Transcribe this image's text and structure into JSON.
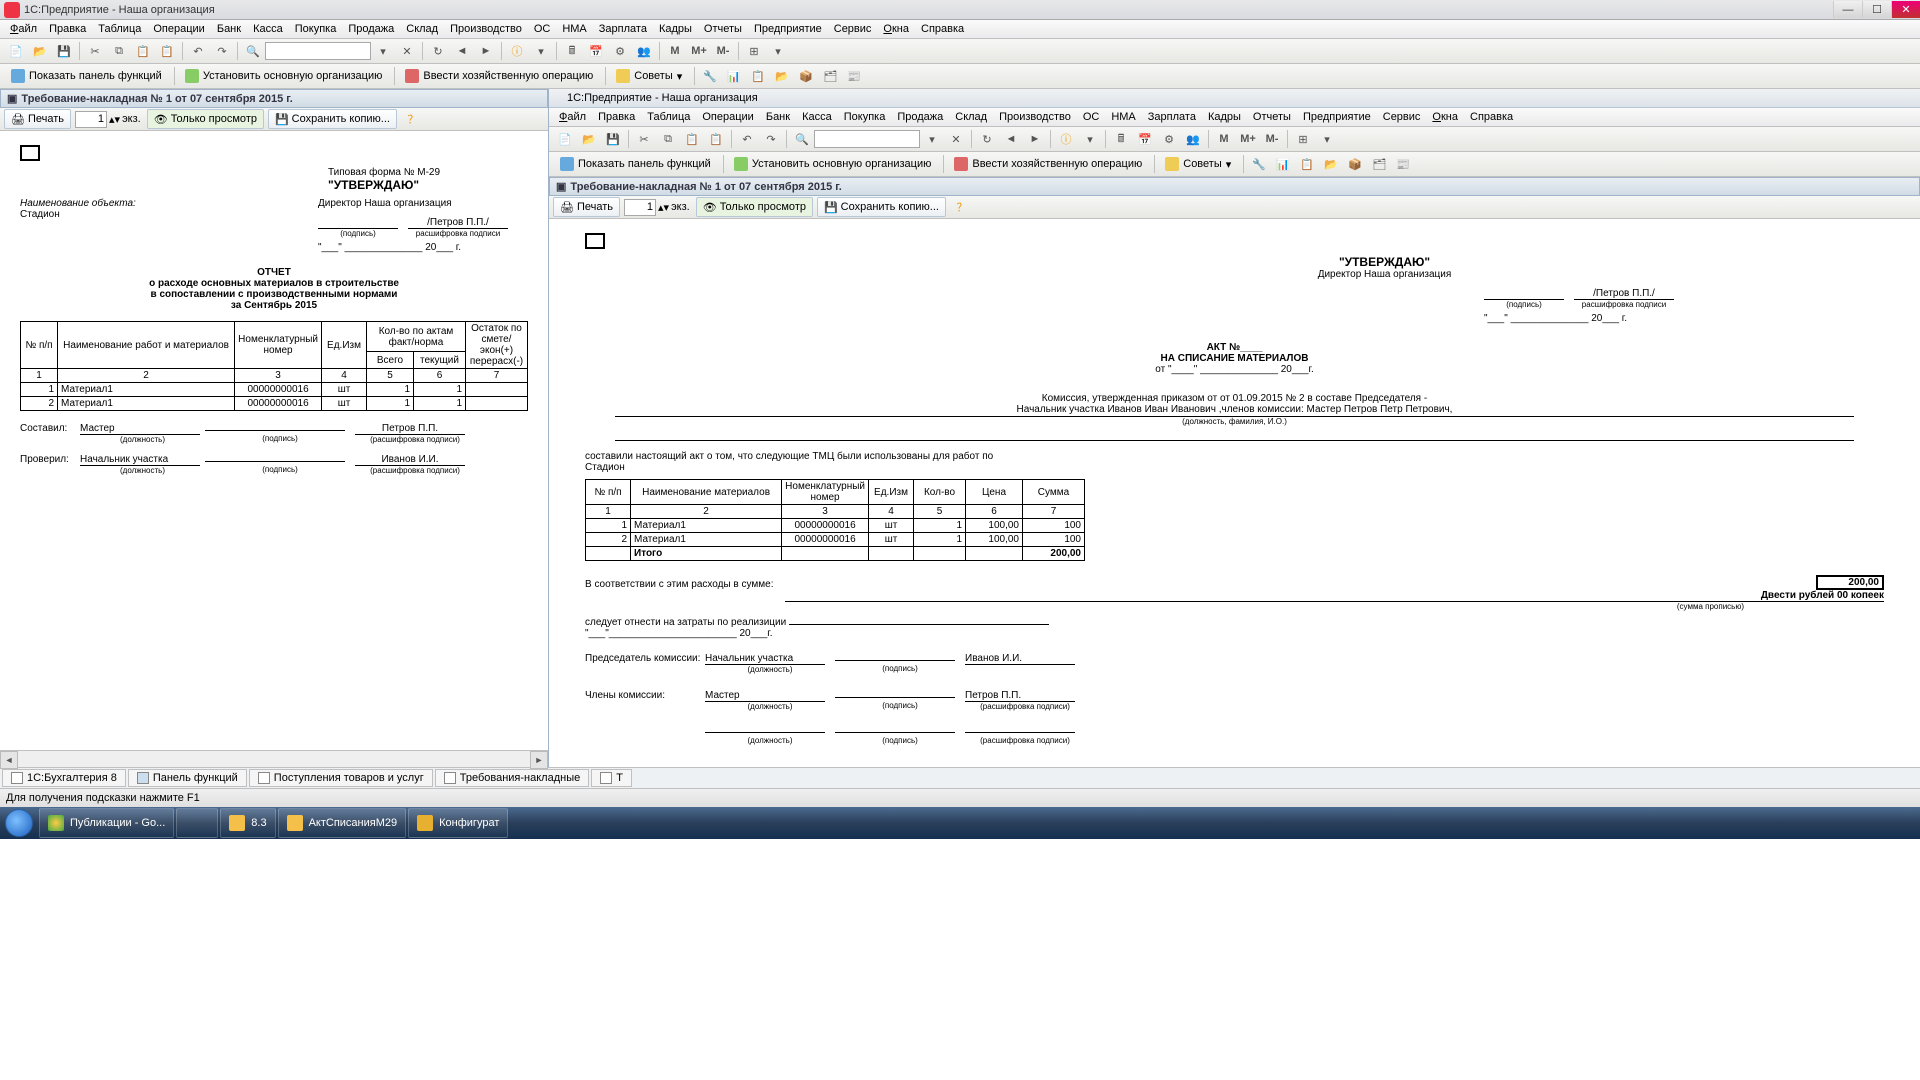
{
  "win1": {
    "title": "1С:Предприятие - Наша организация",
    "menu": [
      "Файл",
      "Правка",
      "Таблица",
      "Операции",
      "Банк",
      "Касса",
      "Покупка",
      "Продажа",
      "Склад",
      "Производство",
      "ОС",
      "НМА",
      "Зарплата",
      "Кадры",
      "Отчеты",
      "Предприятие",
      "Сервис",
      "Окна",
      "Справка"
    ],
    "cmd_panel": "Показать панель функций",
    "cmd_org": "Установить основную организацию",
    "cmd_oper": "Ввести хозяйственную операцию",
    "cmd_tips": "Советы",
    "m_bold": "M",
    "m_plus": "M+",
    "m_minus": "M-",
    "doc_title": "Требование-накладная № 1 от 07 сентября 2015 г.",
    "print": "Печать",
    "copies": "1",
    "copies_suffix": "экз.",
    "view_only": "Только просмотр",
    "save_copy": "Сохранить копию...",
    "tabs": {
      "buh": "1С:Бухгалтерия 8",
      "funcs": "Панель функций",
      "goods": "Поступления товаров и услуг",
      "reqs": "Требования-накладные",
      "t": "Т"
    },
    "status": "Для получения подсказки нажмите F1"
  },
  "doc1": {
    "form_no": "Типовая форма № М-29",
    "approve": "\"УТВЕРЖДАЮ\"",
    "obj_label": "Наименование объекта:",
    "obj": "Стадион",
    "director": "Директор Наша организация",
    "sig_name": "/Петров П.П./",
    "sig_sub1": "(подпись)",
    "sig_sub2": "расшифровка подписи",
    "date_mask": "\"___\" ______________ 20___ г.",
    "rpt1": "ОТЧЕТ",
    "rpt2": "о расходе основных материалов в строительстве",
    "rpt3": "в сопоставлении с производственными нормами",
    "rpt4": "за Сентябрь 2015",
    "th": {
      "n": "№ п/п",
      "name": "Наименование работ и материалов",
      "nom": "Номенклатурный номер",
      "unit": "Ед.Изм",
      "qty": "Кол-во по актам факт/норма",
      "total": "Всего",
      "cur": "текущий",
      "rest": "Остаток по смете/экон(+) перерасх(-)"
    },
    "colnums": [
      "1",
      "2",
      "3",
      "4",
      "5",
      "6",
      "7"
    ],
    "rows": [
      {
        "n": "1",
        "name": "Материал1",
        "code": "00000000016",
        "unit": "шт",
        "total": "1",
        "cur": "1",
        "rest": ""
      },
      {
        "n": "2",
        "name": "Материал1",
        "code": "00000000016",
        "unit": "шт",
        "total": "1",
        "cur": "1",
        "rest": ""
      }
    ],
    "made": "Составил:",
    "made_pos": "Мастер",
    "made_name": "Петров П.П.",
    "check": "Проверил:",
    "check_pos": "Начальник участка",
    "check_name": "Иванов И.И.",
    "sub_pos": "(должность)",
    "sub_sig": "(подпись)",
    "sub_dec": "(расшифровка подписи)"
  },
  "win2": {
    "title": "1С:Предприятие - Наша организация",
    "menu": [
      "Файл",
      "Правка",
      "Таблица",
      "Операции",
      "Банк",
      "Касса",
      "Покупка",
      "Продажа",
      "Склад",
      "Производство",
      "ОС",
      "НМА",
      "Зарплата",
      "Кадры",
      "Отчеты",
      "Предприятие",
      "Сервис",
      "Окна",
      "Справка"
    ],
    "doc_title": "Требование-накладная № 1 от 07 сентября 2015 г."
  },
  "doc2": {
    "approve": "\"УТВЕРЖДАЮ\"",
    "director": "Директор Наша организация",
    "sig_name": "/Петров П.П./",
    "sig_sub1": "(подпись)",
    "sig_sub2": "расшифровка подписи",
    "date_mask": "\"___\" ______________ 20___ г.",
    "akt_no": "АКТ №____",
    "akt_title": "НА СПИСАНИЕ МАТЕРИАЛОВ",
    "akt_date": "от \"____\" ______________ 20___г.",
    "comm1": "Комиссия, утвержденная приказом от  от  01.09.2015 №  2 в составе Председателя -",
    "comm2": "Начальник участка Иванов Иван Иванович ,членов комиссии: Мастер Петров Петр Петрович,",
    "comm_sub": "(должность, фамилия, И.О.)",
    "intro": "составили настоящий акт о том, что следующие ТМЦ были использованы для работ по",
    "obj": "Стадион",
    "th": {
      "n": "№ п/п",
      "name": "Наименование материалов",
      "nom": "Номенклатурный номер",
      "unit": "Ед.Изм",
      "qty": "Кол-во",
      "price": "Цена",
      "sum": "Сумма"
    },
    "colnums": [
      "1",
      "2",
      "3",
      "4",
      "5",
      "6",
      "7"
    ],
    "rows": [
      {
        "n": "1",
        "name": "Материал1",
        "code": "00000000016",
        "unit": "шт",
        "qty": "1",
        "price": "100,00",
        "sum": "100"
      },
      {
        "n": "2",
        "name": "Материал1",
        "code": "00000000016",
        "unit": "шт",
        "qty": "1",
        "price": "100,00",
        "sum": "100"
      }
    ],
    "total_lbl": "Итого",
    "total_sum": "200,00",
    "expense_text": "В соответствии с этим расходы в сумме:",
    "expense_val": "200,00",
    "in_words": "Двести рублей 00 копеек",
    "in_words_sub": "(сумма прописью)",
    "should": "следует отнести на затраты по реализиции",
    "date2": "\"___\"_______________________ 20___г.",
    "chair": "Председатель комиссии:",
    "chair_pos": "Начальник участка",
    "chair_name": "Иванов И.И.",
    "members": "Члены комиссии:",
    "mem_pos": "Мастер",
    "mem_name": "Петров П.П."
  },
  "taskbar": {
    "pub": "Публикации - Go...",
    "f83": "8.3",
    "fakt": "АктСписанияМ29",
    "konf": "Конфигурат"
  }
}
